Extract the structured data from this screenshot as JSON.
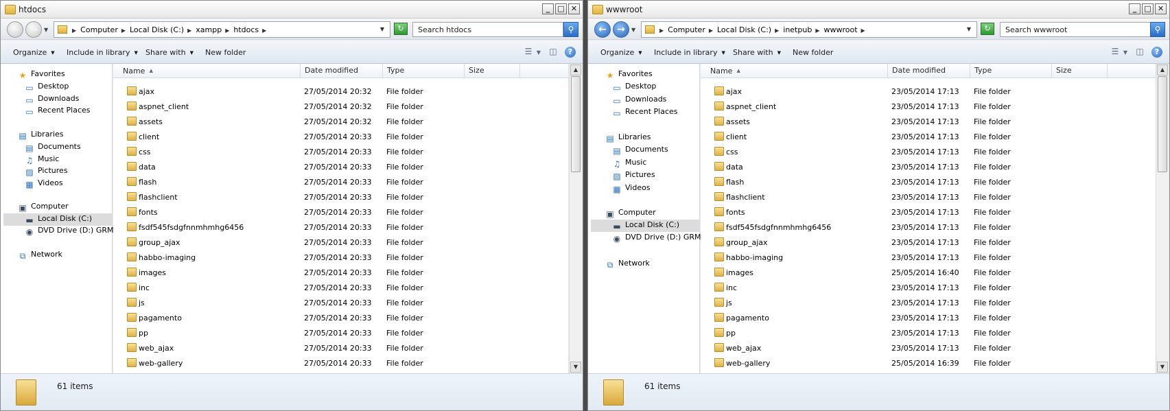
{
  "windows": [
    {
      "title": "htdocs",
      "forward_enabled": false,
      "breadcrumb": [
        "Computer",
        "Local Disk (C:)",
        "xampp",
        "htdocs"
      ],
      "search_placeholder": "Search htdocs",
      "toolbar": [
        "Organize",
        "Include in library",
        "Share with",
        "New folder"
      ],
      "nav": {
        "favorites": "Favorites",
        "fav_items": [
          "Desktop",
          "Downloads",
          "Recent Places"
        ],
        "libraries": "Libraries",
        "lib_items": [
          "Documents",
          "Music",
          "Pictures",
          "Videos"
        ],
        "computer": "Computer",
        "comp_items": [
          "Local Disk (C:)",
          "DVD Drive (D:) GRMSX"
        ],
        "network": "Network"
      },
      "columns": [
        "Name",
        "Date modified",
        "Type",
        "Size"
      ],
      "files": [
        {
          "name": "ajax",
          "date": "27/05/2014 20:32",
          "type": "File folder"
        },
        {
          "name": "aspnet_client",
          "date": "27/05/2014 20:32",
          "type": "File folder"
        },
        {
          "name": "assets",
          "date": "27/05/2014 20:32",
          "type": "File folder"
        },
        {
          "name": "client",
          "date": "27/05/2014 20:33",
          "type": "File folder"
        },
        {
          "name": "css",
          "date": "27/05/2014 20:33",
          "type": "File folder"
        },
        {
          "name": "data",
          "date": "27/05/2014 20:33",
          "type": "File folder"
        },
        {
          "name": "flash",
          "date": "27/05/2014 20:33",
          "type": "File folder"
        },
        {
          "name": "flashclient",
          "date": "27/05/2014 20:33",
          "type": "File folder"
        },
        {
          "name": "fonts",
          "date": "27/05/2014 20:33",
          "type": "File folder"
        },
        {
          "name": "fsdf545fsdgfnnmhmhg6456",
          "date": "27/05/2014 20:33",
          "type": "File folder"
        },
        {
          "name": "group_ajax",
          "date": "27/05/2014 20:33",
          "type": "File folder"
        },
        {
          "name": "habbo-imaging",
          "date": "27/05/2014 20:33",
          "type": "File folder"
        },
        {
          "name": "images",
          "date": "27/05/2014 20:33",
          "type": "File folder"
        },
        {
          "name": "inc",
          "date": "27/05/2014 20:33",
          "type": "File folder"
        },
        {
          "name": "js",
          "date": "27/05/2014 20:33",
          "type": "File folder"
        },
        {
          "name": "pagamento",
          "date": "27/05/2014 20:33",
          "type": "File folder"
        },
        {
          "name": "pp",
          "date": "27/05/2014 20:33",
          "type": "File folder"
        },
        {
          "name": "web_ajax",
          "date": "27/05/2014 20:33",
          "type": "File folder"
        },
        {
          "name": "web-gallery",
          "date": "27/05/2014 20:33",
          "type": "File folder"
        }
      ],
      "item_count": "61 items"
    },
    {
      "title": "wwwroot",
      "forward_enabled": true,
      "breadcrumb": [
        "Computer",
        "Local Disk (C:)",
        "inetpub",
        "wwwroot"
      ],
      "search_placeholder": "Search wwwroot",
      "toolbar": [
        "Organize",
        "Include in library",
        "Share with",
        "New folder"
      ],
      "nav": {
        "favorites": "Favorites",
        "fav_items": [
          "Desktop",
          "Downloads",
          "Recent Places"
        ],
        "libraries": "Libraries",
        "lib_items": [
          "Documents",
          "Music",
          "Pictures",
          "Videos"
        ],
        "computer": "Computer",
        "comp_items": [
          "Local Disk (C:)",
          "DVD Drive (D:) GRMSX"
        ],
        "network": "Network"
      },
      "columns": [
        "Name",
        "Date modified",
        "Type",
        "Size"
      ],
      "files": [
        {
          "name": "ajax",
          "date": "23/05/2014 17:13",
          "type": "File folder"
        },
        {
          "name": "aspnet_client",
          "date": "23/05/2014 17:13",
          "type": "File folder"
        },
        {
          "name": "assets",
          "date": "23/05/2014 17:13",
          "type": "File folder"
        },
        {
          "name": "client",
          "date": "23/05/2014 17:13",
          "type": "File folder"
        },
        {
          "name": "css",
          "date": "23/05/2014 17:13",
          "type": "File folder"
        },
        {
          "name": "data",
          "date": "23/05/2014 17:13",
          "type": "File folder"
        },
        {
          "name": "flash",
          "date": "23/05/2014 17:13",
          "type": "File folder"
        },
        {
          "name": "flashclient",
          "date": "23/05/2014 17:13",
          "type": "File folder"
        },
        {
          "name": "fonts",
          "date": "23/05/2014 17:13",
          "type": "File folder"
        },
        {
          "name": "fsdf545fsdgfnnmhmhg6456",
          "date": "23/05/2014 17:13",
          "type": "File folder"
        },
        {
          "name": "group_ajax",
          "date": "23/05/2014 17:13",
          "type": "File folder"
        },
        {
          "name": "habbo-imaging",
          "date": "23/05/2014 17:13",
          "type": "File folder"
        },
        {
          "name": "images",
          "date": "25/05/2014 16:40",
          "type": "File folder"
        },
        {
          "name": "inc",
          "date": "23/05/2014 17:13",
          "type": "File folder"
        },
        {
          "name": "js",
          "date": "23/05/2014 17:13",
          "type": "File folder"
        },
        {
          "name": "pagamento",
          "date": "23/05/2014 17:13",
          "type": "File folder"
        },
        {
          "name": "pp",
          "date": "23/05/2014 17:13",
          "type": "File folder"
        },
        {
          "name": "web_ajax",
          "date": "23/05/2014 17:13",
          "type": "File folder"
        },
        {
          "name": "web-gallery",
          "date": "25/05/2014 16:39",
          "type": "File folder"
        }
      ],
      "item_count": "61 items"
    }
  ]
}
